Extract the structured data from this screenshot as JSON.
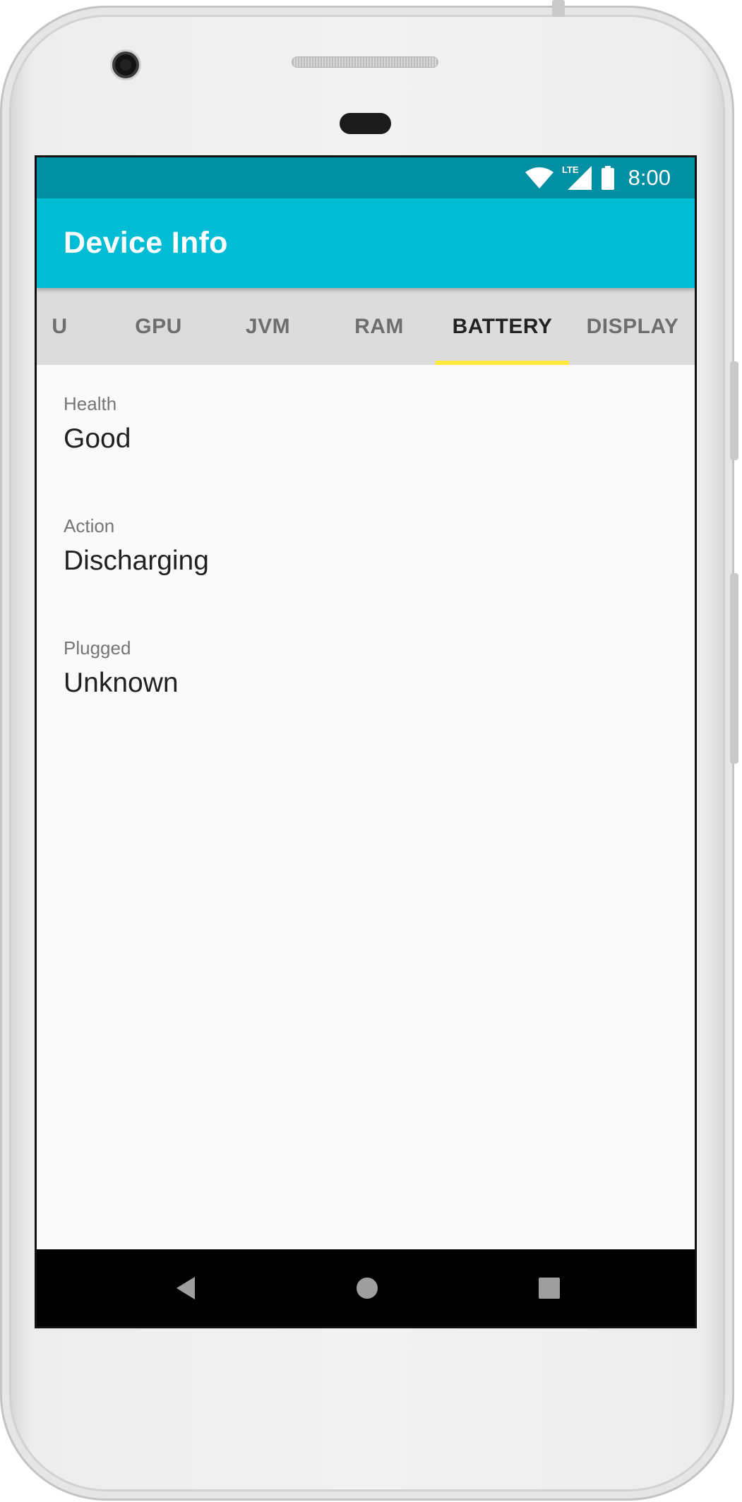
{
  "colors": {
    "status_bar": "#008fa3",
    "app_bar": "#00bcd4",
    "tab_background": "#dcdcdc",
    "tab_indicator": "#ffeb3b",
    "nav_bar": "#000000",
    "system_icons": "#ffffff",
    "nav_icons": "#9e9e9e"
  },
  "status_bar": {
    "network_label": "LTE",
    "time": "8:00",
    "icons": [
      "wifi-icon",
      "cellular-signal-icon",
      "battery-icon"
    ]
  },
  "app_bar": {
    "title": "Device Info"
  },
  "tabs": [
    {
      "label": "U",
      "active": false
    },
    {
      "label": "GPU",
      "active": false
    },
    {
      "label": "JVM",
      "active": false
    },
    {
      "label": "RAM",
      "active": false
    },
    {
      "label": "BATTERY",
      "active": true
    },
    {
      "label": "DISPLAY",
      "active": false
    }
  ],
  "battery_info": [
    {
      "label": "Health",
      "value": "Good"
    },
    {
      "label": "Action",
      "value": "Discharging"
    },
    {
      "label": "Plugged",
      "value": "Unknown"
    }
  ],
  "nav_bar": {
    "buttons": [
      "back-icon",
      "home-icon",
      "recent-apps-icon"
    ]
  }
}
